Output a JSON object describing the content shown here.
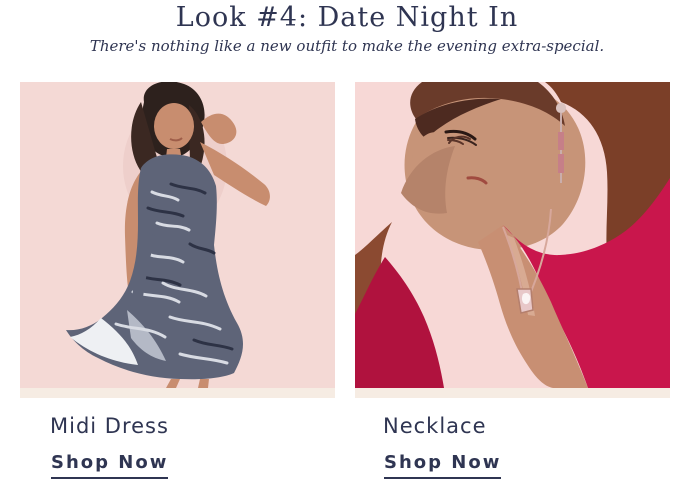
{
  "header": {
    "title": "Look #4: Date Night In",
    "subtitle": "There's nothing like a new outfit to make the evening extra-special."
  },
  "products": [
    {
      "name": "Midi Dress",
      "cta": "Shop Now",
      "image_alt": "Model wearing a black and white print sleeveless midi dress",
      "background": "#f4d9d5"
    },
    {
      "name": "Necklace",
      "cta": "Shop Now",
      "image_alt": "Model in a magenta top wearing a rose gold pendant necklace",
      "background": "#f7d8d6"
    }
  ],
  "colors": {
    "text": "#2f3552",
    "strip": "#f6ece3",
    "dress_print": "#5e6478",
    "top": "#c9164c"
  }
}
